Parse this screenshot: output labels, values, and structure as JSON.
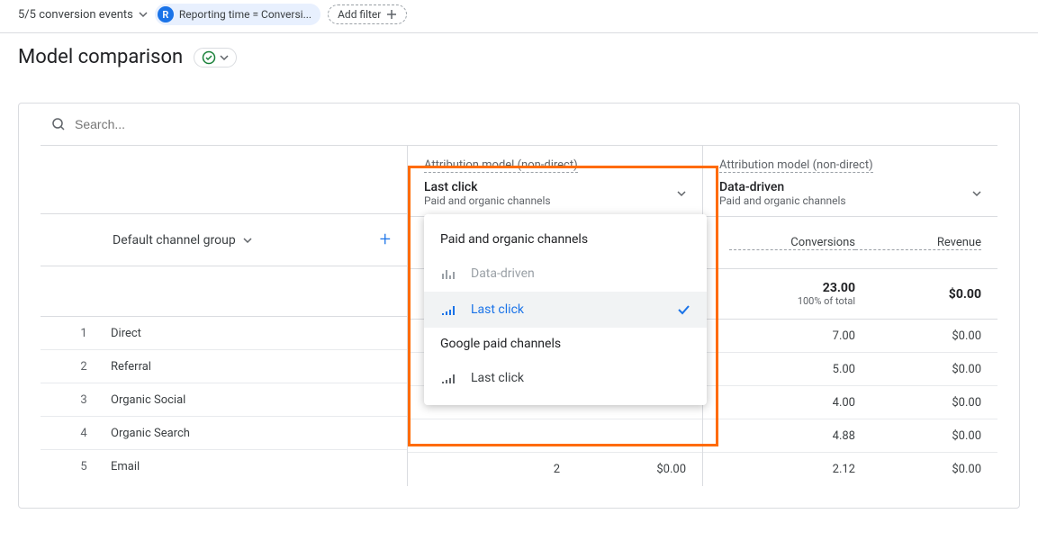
{
  "topbar": {
    "conversion_events": "5/5 conversion events",
    "reporting_badge": "R",
    "reporting_label": "Reporting time = Conversi...",
    "add_filter": "Add filter"
  },
  "page_title": "Model comparison",
  "search": {
    "placeholder": "Search..."
  },
  "dimension": {
    "label": "Default channel group"
  },
  "models": {
    "header_label": "Attribution model (non-direct)",
    "left": {
      "name": "Last click",
      "sub": "Paid and organic channels"
    },
    "right": {
      "name": "Data-driven",
      "sub": "Paid and organic channels"
    }
  },
  "metrics": {
    "conversions": "Conversions",
    "revenue": "Revenue"
  },
  "totals": {
    "right": {
      "conversions": "23.00",
      "conversions_sub": "100% of total",
      "revenue": "$0.00"
    }
  },
  "rows": [
    {
      "idx": "1",
      "name": "Direct",
      "left_conv": "",
      "left_rev": "",
      "right_conv": "7.00",
      "right_rev": "$0.00"
    },
    {
      "idx": "2",
      "name": "Referral",
      "left_conv": "",
      "left_rev": "",
      "right_conv": "5.00",
      "right_rev": "$0.00"
    },
    {
      "idx": "3",
      "name": "Organic Social",
      "left_conv": "",
      "left_rev": "",
      "right_conv": "4.00",
      "right_rev": "$0.00"
    },
    {
      "idx": "4",
      "name": "Organic Search",
      "left_conv": "",
      "left_rev": "",
      "right_conv": "4.88",
      "right_rev": "$0.00"
    },
    {
      "idx": "5",
      "name": "Email",
      "left_conv": "2",
      "left_rev": "$0.00",
      "right_conv": "2.12",
      "right_rev": "$0.00"
    }
  ],
  "dropdown": {
    "section1": "Paid and organic channels",
    "option_data_driven": "Data-driven",
    "option_last_click": "Last click",
    "section2": "Google paid channels",
    "option_last_click2": "Last click"
  }
}
